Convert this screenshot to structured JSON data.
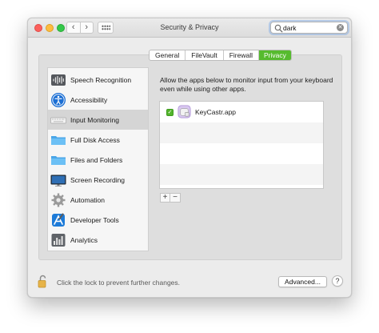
{
  "window": {
    "title": "Security & Privacy"
  },
  "toolbar": {
    "back_glyph": "‹",
    "forward_glyph": "›"
  },
  "search": {
    "value": "dark",
    "clear_glyph": "✕"
  },
  "tabs": [
    {
      "label": "General",
      "active": false
    },
    {
      "label": "FileVault",
      "active": false
    },
    {
      "label": "Firewall",
      "active": false
    },
    {
      "label": "Privacy",
      "active": true
    }
  ],
  "sidebar": {
    "items": [
      {
        "label": "Speech Recognition",
        "icon": "speech-recognition-icon",
        "selected": false
      },
      {
        "label": "Accessibility",
        "icon": "accessibility-icon",
        "selected": false
      },
      {
        "label": "Input Monitoring",
        "icon": "keyboard-icon",
        "selected": true
      },
      {
        "label": "Full Disk Access",
        "icon": "folder-icon",
        "selected": false
      },
      {
        "label": "Files and Folders",
        "icon": "folder-icon",
        "selected": false
      },
      {
        "label": "Screen Recording",
        "icon": "screen-icon",
        "selected": false
      },
      {
        "label": "Automation",
        "icon": "gear-icon",
        "selected": false
      },
      {
        "label": "Developer Tools",
        "icon": "developer-tools-icon",
        "selected": false
      },
      {
        "label": "Analytics",
        "icon": "analytics-icon",
        "selected": false
      }
    ]
  },
  "main": {
    "description": "Allow the apps below to monitor input from your keyboard even while using other apps.",
    "apps": [
      {
        "name": "KeyCastr.app",
        "checked": true,
        "icon": "keycastr-app-icon"
      }
    ],
    "add_label": "+",
    "remove_label": "−"
  },
  "footer": {
    "lock_text": "Click the lock to prevent further changes.",
    "advanced_label": "Advanced...",
    "help_label": "?"
  },
  "colors": {
    "accent_green": "#56bb2e",
    "checkbox_green": "#53b42c"
  }
}
